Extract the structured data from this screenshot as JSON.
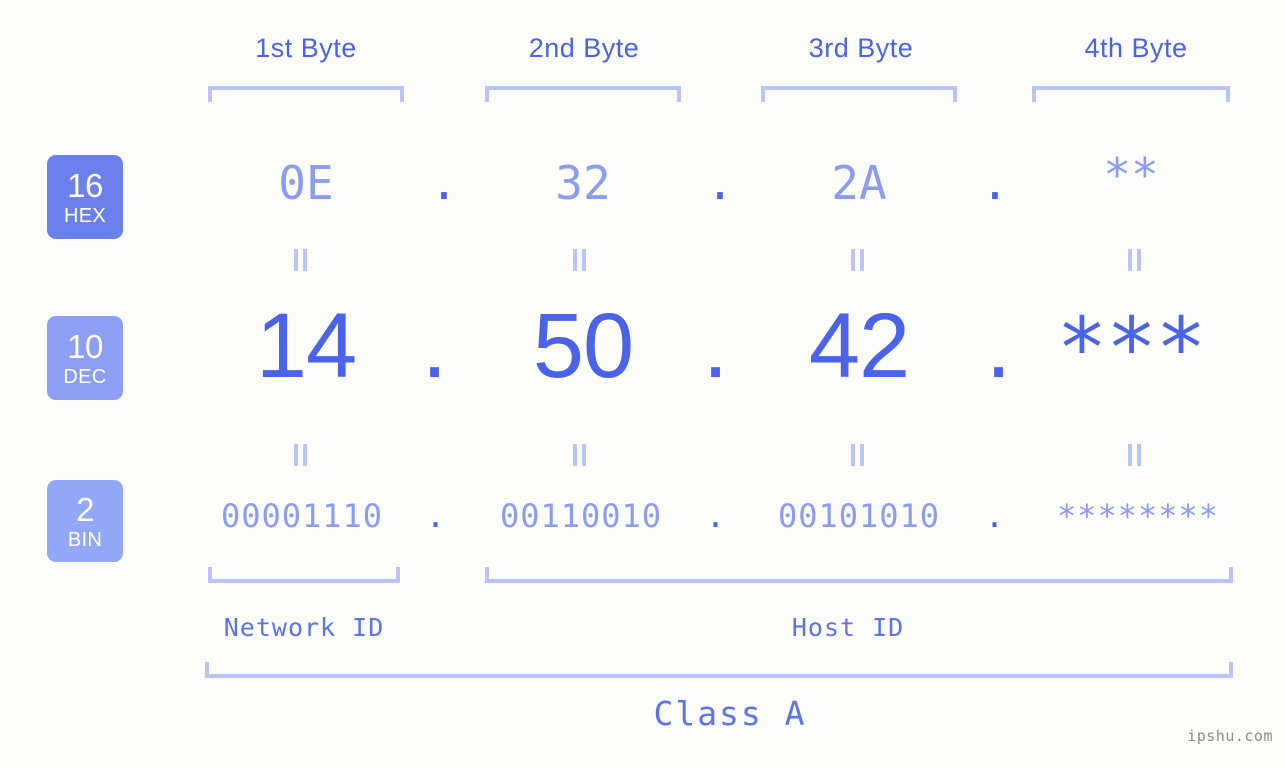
{
  "background_color": "#fcfdf8",
  "accent_color": "#4a63e8",
  "accent_light_color": "#8b9cf2",
  "bracket_color": "#b9c4fa",
  "columns": [
    {
      "label": "1st Byte"
    },
    {
      "label": "2nd Byte"
    },
    {
      "label": "3rd Byte"
    },
    {
      "label": "4th Byte"
    }
  ],
  "rows": [
    {
      "badge_number": "16",
      "badge_name": "HEX",
      "badge_color": "#6c80ec",
      "values": [
        "0E",
        "32",
        "2A",
        "**"
      ]
    },
    {
      "badge_number": "10",
      "badge_name": "DEC",
      "badge_color": "#8e9ef4",
      "values": [
        "14",
        "50",
        "42",
        "***"
      ]
    },
    {
      "badge_number": "2",
      "badge_name": "BIN",
      "badge_color": "#93a8f7",
      "values": [
        "00001110",
        "00110010",
        "00101010",
        "********"
      ]
    }
  ],
  "separator_dot": ".",
  "id_spans": [
    {
      "label": "Network ID"
    },
    {
      "label": "Host ID"
    }
  ],
  "class_label": "Class A",
  "watermark": "ipshu.com"
}
